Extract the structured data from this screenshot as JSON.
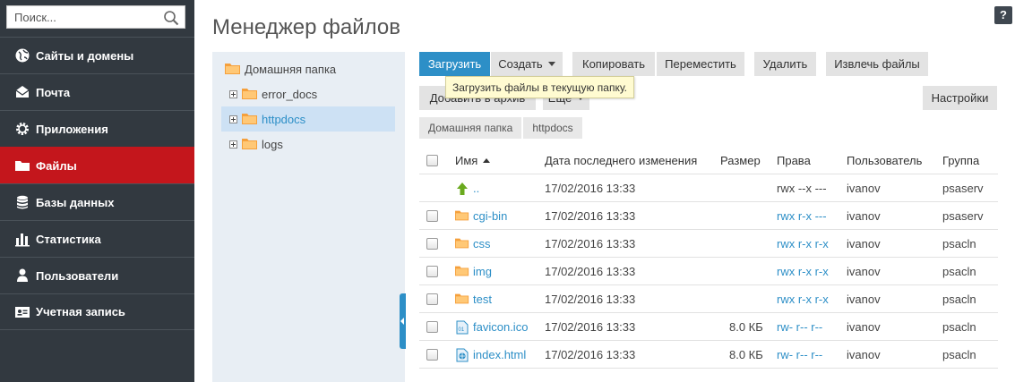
{
  "search": {
    "placeholder": "Поиск..."
  },
  "sidebar": {
    "items": [
      {
        "label": "Сайты и домены",
        "icon": "globe-icon",
        "active": false
      },
      {
        "label": "Почта",
        "icon": "envelope-icon",
        "active": false
      },
      {
        "label": "Приложения",
        "icon": "gear-icon",
        "active": false
      },
      {
        "label": "Файлы",
        "icon": "folder-icon",
        "active": true
      },
      {
        "label": "Базы данных",
        "icon": "database-icon",
        "active": false
      },
      {
        "label": "Статистика",
        "icon": "bar-chart-icon",
        "active": false
      },
      {
        "label": "Пользователи",
        "icon": "user-icon",
        "active": false
      },
      {
        "label": "Учетная запись",
        "icon": "id-card-icon",
        "active": false
      }
    ]
  },
  "header": {
    "title": "Менеджер файлов",
    "help_label": "?"
  },
  "tree": {
    "root": "Домашняя папка",
    "children": [
      "error_docs",
      "httpdocs",
      "logs"
    ],
    "selected": "httpdocs"
  },
  "toolbar": {
    "upload": "Загрузить",
    "create": "Создать",
    "copy": "Копировать",
    "move": "Переместить",
    "delete": "Удалить",
    "extract": "Извлечь файлы",
    "archive": "Добавить в архив",
    "more": "Еще",
    "settings": "Настройки"
  },
  "tooltip": {
    "text": "Загрузить файлы в текущую папку."
  },
  "breadcrumb": [
    "Домашняя папка",
    "httpdocs"
  ],
  "table": {
    "columns": {
      "name": "Имя",
      "modified": "Дата последнего изменения",
      "size": "Размер",
      "perms": "Права",
      "user": "Пользователь",
      "group": "Группа"
    },
    "rows": [
      {
        "name": "..",
        "type": "parent",
        "modified": "17/02/2016 13:33",
        "size": "",
        "perms": "rwx --x ---",
        "user": "ivanov",
        "group": "psaserv"
      },
      {
        "name": "cgi-bin",
        "type": "folder",
        "modified": "17/02/2016 13:33",
        "size": "",
        "perms": "rwx r-x ---",
        "user": "ivanov",
        "group": "psaserv"
      },
      {
        "name": "css",
        "type": "folder",
        "modified": "17/02/2016 13:33",
        "size": "",
        "perms": "rwx r-x r-x",
        "user": "ivanov",
        "group": "psacln"
      },
      {
        "name": "img",
        "type": "folder",
        "modified": "17/02/2016 13:33",
        "size": "",
        "perms": "rwx r-x r-x",
        "user": "ivanov",
        "group": "psacln"
      },
      {
        "name": "test",
        "type": "folder",
        "modified": "17/02/2016 13:33",
        "size": "",
        "perms": "rwx r-x r-x",
        "user": "ivanov",
        "group": "psacln"
      },
      {
        "name": "favicon.ico",
        "type": "binary",
        "modified": "17/02/2016 13:33",
        "size": "8.0 КБ",
        "perms": "rw- r-- r--",
        "user": "ivanov",
        "group": "psacln"
      },
      {
        "name": "index.html",
        "type": "html",
        "modified": "17/02/2016 13:33",
        "size": "8.0 КБ",
        "perms": "rw- r-- r--",
        "user": "ivanov",
        "group": "psacln"
      }
    ]
  },
  "colors": {
    "accent": "#2d8fc7",
    "active_nav": "#c4161c",
    "sidebar_bg": "#323940",
    "folder": "#f5a03c"
  }
}
